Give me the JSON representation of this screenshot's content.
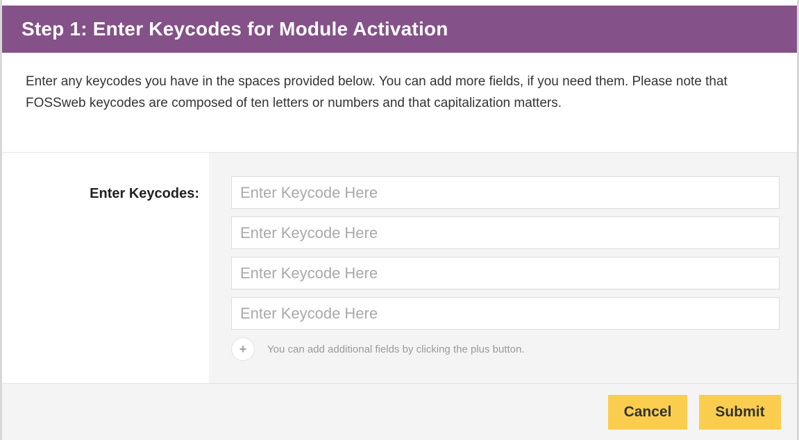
{
  "header": {
    "title": "Step 1: Enter Keycodes for Module Activation"
  },
  "intro": {
    "text": "Enter any keycodes you have in the spaces provided below. You can add more fields, if you need them. Please note that FOSSweb keycodes are composed of ten letters or numbers and that capitalization matters."
  },
  "form": {
    "label": "Enter Keycodes:",
    "fields": [
      {
        "value": "",
        "placeholder": "Enter Keycode Here"
      },
      {
        "value": "",
        "placeholder": "Enter Keycode Here"
      },
      {
        "value": "",
        "placeholder": "Enter Keycode Here"
      },
      {
        "value": "",
        "placeholder": "Enter Keycode Here"
      }
    ],
    "add_button_icon": "plus-icon",
    "add_button_glyph": "+",
    "add_hint": "You can add additional fields by clicking the plus button."
  },
  "footer": {
    "cancel_label": "Cancel",
    "submit_label": "Submit"
  },
  "colors": {
    "header_bg": "#845189",
    "button_bg": "#fbcd4e",
    "panel_bg": "#f4f4f4"
  }
}
